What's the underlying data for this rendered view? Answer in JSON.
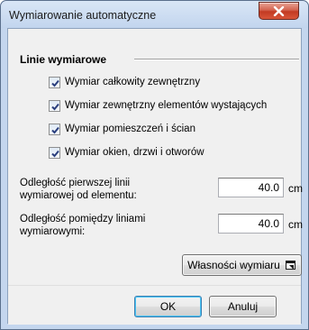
{
  "window": {
    "title": "Wymiarowanie automatyczne",
    "close_icon": "close-icon"
  },
  "group": {
    "title": "Linie wymiarowe",
    "options": [
      {
        "label": "Wymiar całkowity zewnętrzny",
        "checked": true
      },
      {
        "label": "Wymiar zewnętrzny elementów wystających",
        "checked": true
      },
      {
        "label": "Wymiar pomieszczeń i ścian",
        "checked": true
      },
      {
        "label": "Wymiar okien, drzwi i otworów",
        "checked": true
      }
    ]
  },
  "fields": [
    {
      "label": "Odległość pierwszej linii wymiarowej od elementu:",
      "value": "40.0",
      "unit": "cm"
    },
    {
      "label": "Odległość pomiędzy liniami wymiarowymi:",
      "value": "40.0",
      "unit": "cm"
    }
  ],
  "buttons": {
    "properties": "Własności wymiaru",
    "properties_icon": "dialog-window-icon",
    "ok": "OK",
    "cancel": "Anuluj"
  }
}
